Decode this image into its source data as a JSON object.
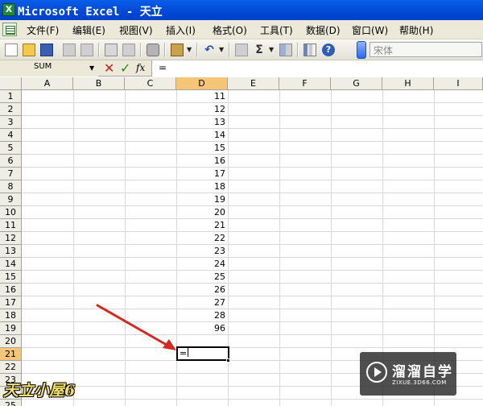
{
  "window": {
    "title": "Microsoft Excel - 天立"
  },
  "menu": {
    "items": [
      "文件(F)",
      "编辑(E)",
      "视图(V)",
      "插入(I)",
      "格式(O)",
      "工具(T)",
      "数据(D)",
      "窗口(W)",
      "帮助(H)"
    ]
  },
  "toolbar": {
    "font_name": "宋体"
  },
  "formula_bar": {
    "name_box": "SUM",
    "fx": "fx",
    "content": "="
  },
  "sheet": {
    "columns": [
      "A",
      "B",
      "C",
      "D",
      "E",
      "F",
      "G",
      "H",
      "I"
    ],
    "rows": [
      "1",
      "2",
      "3",
      "4",
      "5",
      "6",
      "7",
      "8",
      "9",
      "10",
      "11",
      "12",
      "13",
      "14",
      "15",
      "16",
      "17",
      "18",
      "19",
      "20",
      "21",
      "22",
      "23",
      "24",
      "25"
    ],
    "column_d_values": [
      "11",
      "12",
      "13",
      "14",
      "15",
      "16",
      "17",
      "18",
      "19",
      "20",
      "21",
      "22",
      "23",
      "24",
      "25",
      "26",
      "27",
      "28",
      "96"
    ],
    "active_cell": {
      "ref": "D21",
      "text": "="
    }
  },
  "colors": {
    "accent": "#f6c576",
    "arrow": "#d12a20",
    "title_bar": "#0047d6"
  },
  "watermark": {
    "left_text": "天立小屋6",
    "brand": "溜溜自学",
    "url": "ZIXUE.3D66.COM"
  }
}
